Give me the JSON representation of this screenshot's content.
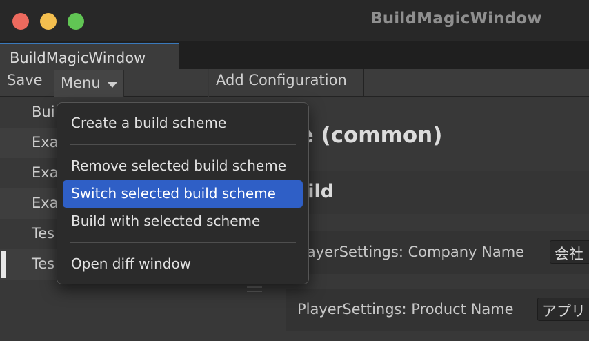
{
  "window": {
    "title": "BuildMagicWindow"
  },
  "tab": {
    "label": "BuildMagicWindow"
  },
  "left_panel": {
    "save_label": "Save",
    "menu_label": "Menu",
    "items": [
      {
        "label": "Bui"
      },
      {
        "label": "Exa"
      },
      {
        "label": "Exa"
      },
      {
        "label": "Exa"
      },
      {
        "label": "Tes"
      },
      {
        "label": "Tes"
      }
    ]
  },
  "right_panel": {
    "add_configuration_label": "Add Configuration",
    "section_title": "le (common)",
    "build_header": "uild",
    "properties": [
      {
        "label": "layerSettings: Company Name",
        "value": "会社"
      },
      {
        "label": "PlayerSettings: Product Name",
        "value": "アプリ"
      }
    ]
  },
  "popup_menu": {
    "items": [
      {
        "label": "Create a build scheme",
        "selected": false
      },
      {
        "label": "Remove selected build scheme",
        "selected": false
      },
      {
        "label": "Switch selected build scheme",
        "selected": true
      },
      {
        "label": "Build with selected scheme",
        "selected": false
      },
      {
        "label": "Open diff window",
        "selected": false
      }
    ]
  },
  "colors": {
    "traffic_close": "#ed6a5e",
    "traffic_minimize": "#f4bf4f",
    "traffic_maximize": "#61c554",
    "selection": "#2f5fc6",
    "tab_accent": "#3a79bb"
  }
}
